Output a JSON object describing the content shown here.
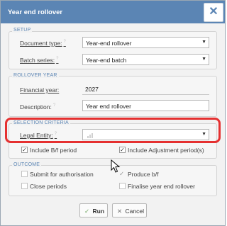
{
  "dialog": {
    "title": "Year end rollover",
    "close_glyph": "✕"
  },
  "setup": {
    "legend": "SETUP",
    "document_type": {
      "label": "Document type:",
      "value": "Year-end rollover"
    },
    "batch_series": {
      "label": "Batch series:",
      "value": "Year-end batch"
    }
  },
  "rollover_year": {
    "legend": "ROLLOVER YEAR",
    "financial_year": {
      "label": "Financial year:",
      "value": "2027"
    },
    "description": {
      "label": "Description:",
      "value": "Year end rollover"
    }
  },
  "selection_criteria": {
    "legend": "SELECTION CRITERIA",
    "legal_entity": {
      "label": "Legal Entity:",
      "value": ""
    },
    "include_bf_period": {
      "label": "Include B/f period",
      "checked": true
    },
    "include_adjustment_periods": {
      "label": "Include Adjustment period(s)",
      "checked": true
    }
  },
  "outcome": {
    "legend": "OUTCOME",
    "submit_for_authorisation": {
      "label": "Submit for authorisation",
      "checked": false
    },
    "produce_bf": {
      "label": "Produce b/f",
      "checked": true
    },
    "close_periods": {
      "label": "Close periods",
      "checked": false
    },
    "finalise_year_end_rollover": {
      "label": "Finalise year end rollover",
      "checked": false
    }
  },
  "buttons": {
    "run_label": "Run",
    "cancel_label": "Cancel"
  },
  "colors": {
    "title_bar": "#5b85b4",
    "legend": "#5b85b4",
    "highlight": "#e53030"
  }
}
